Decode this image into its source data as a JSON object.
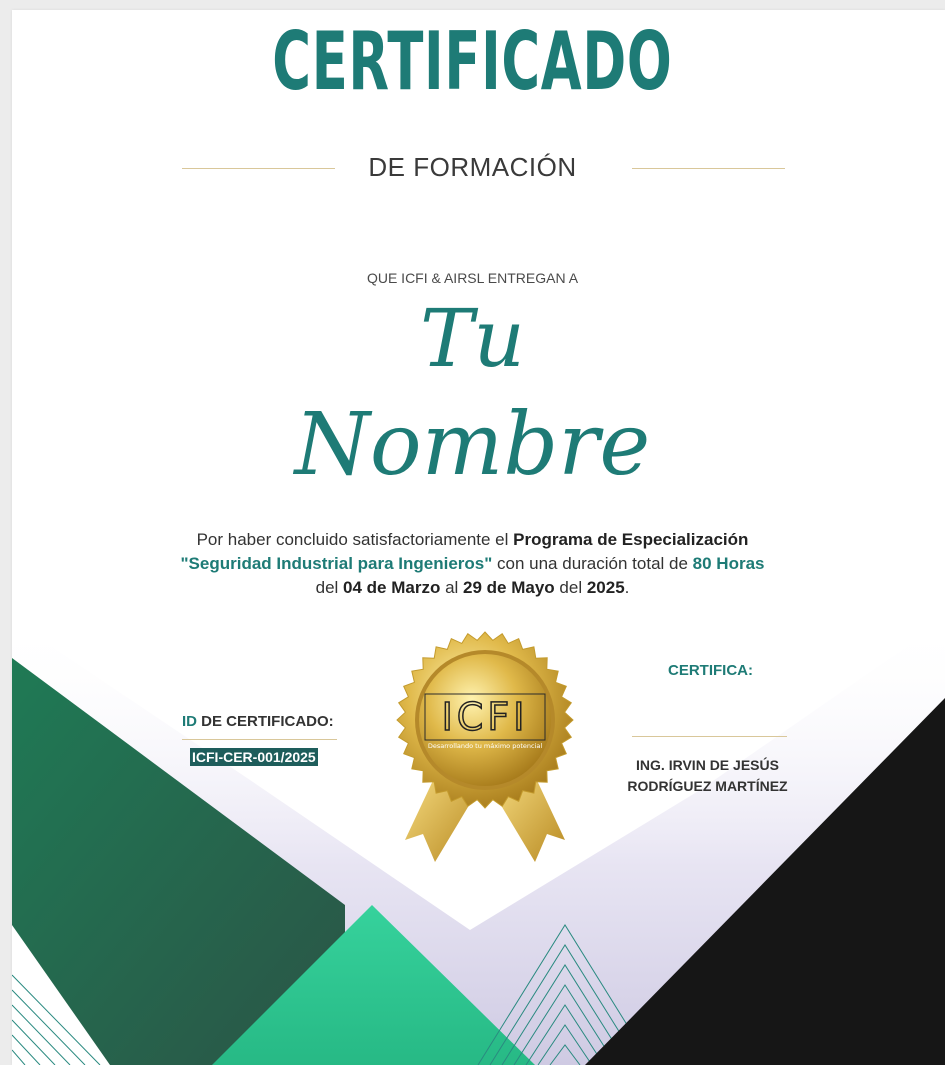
{
  "certificate": {
    "title": "CERTIFICADO",
    "subtitle": "DE FORMACIÓN",
    "issuer_line": "QUE ICFI & AIRSL ENTREGAN A",
    "recipient_line1": "Tu",
    "recipient_line2": "Nombre",
    "body": {
      "p1": "Por haber concluido satisfactoriamente el ",
      "program_type": "Programa de Especialización",
      "program_name": "\"Seguridad Industrial para Ingenieros\"",
      "p2": " con una duración total de ",
      "hours": "80 Horas",
      "p3": "del ",
      "start_date": "04 de Marzo",
      "p4": " al ",
      "end_date": "29 de Mayo",
      "p5": " del ",
      "year": "2025",
      "p6": "."
    },
    "id_key": "ID",
    "id_label_rest": " DE CERTIFICADO:",
    "id_value": "ICFI-CER-001/2025",
    "certifica_label": "CERTIFICA:",
    "signer_line1": "ING. IRVIN DE JESÚS",
    "signer_line2": "RODRÍGUEZ MARTÍNEZ",
    "seal": {
      "logo_text": "ICFI",
      "tagline": "Desarrollando tu máximo potencial"
    }
  },
  "colors": {
    "accent_teal": "#1e7b76",
    "green_dark": "#226b4f",
    "green_light": "#2ec994",
    "black": "#161616",
    "gold": "#d4af37"
  }
}
